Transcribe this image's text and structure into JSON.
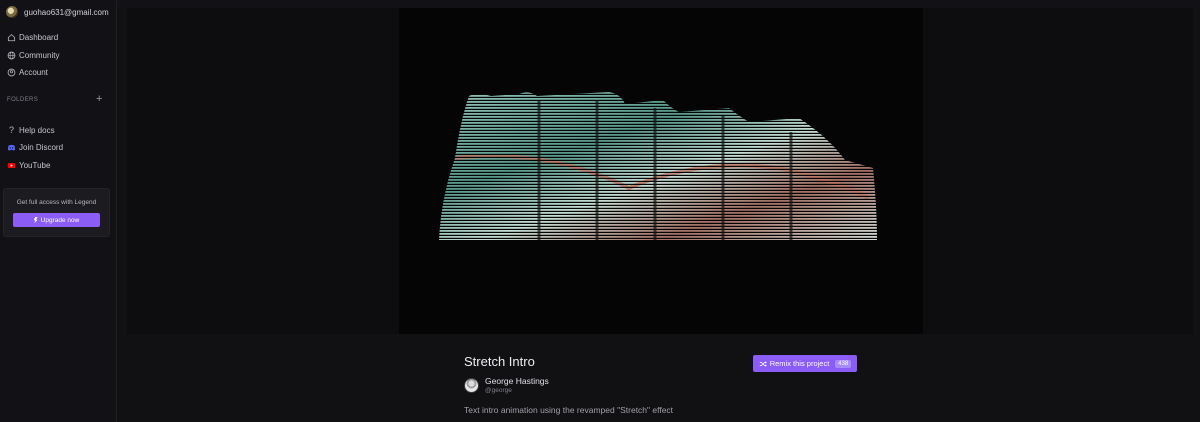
{
  "account": {
    "email": "guohao631@gmail.com"
  },
  "nav": {
    "items": [
      {
        "label": "Dashboard",
        "icon": "home-icon"
      },
      {
        "label": "Community",
        "icon": "globe-icon"
      },
      {
        "label": "Account",
        "icon": "user-circle-icon"
      }
    ],
    "folders_label": "FOLDERS",
    "add_folder": "+",
    "links": [
      {
        "label": "Help docs",
        "icon": "question-icon"
      },
      {
        "label": "Join Discord",
        "icon": "discord-icon",
        "color": "#5865f2"
      },
      {
        "label": "YouTube",
        "icon": "youtube-icon",
        "color": "#ff0000"
      }
    ]
  },
  "upgrade": {
    "text": "Get full access with Legend",
    "button": "Upgrade now"
  },
  "project": {
    "title": "Stretch Intro",
    "remix_label": "Remix this project",
    "remix_count": "438",
    "author_name": "George Hastings",
    "author_handle": "@george",
    "description": "Text intro animation using the revamped \"Stretch\" effect"
  },
  "colors": {
    "accent": "#8b5cf6",
    "background": "#111114",
    "sidebar": "#121216"
  }
}
